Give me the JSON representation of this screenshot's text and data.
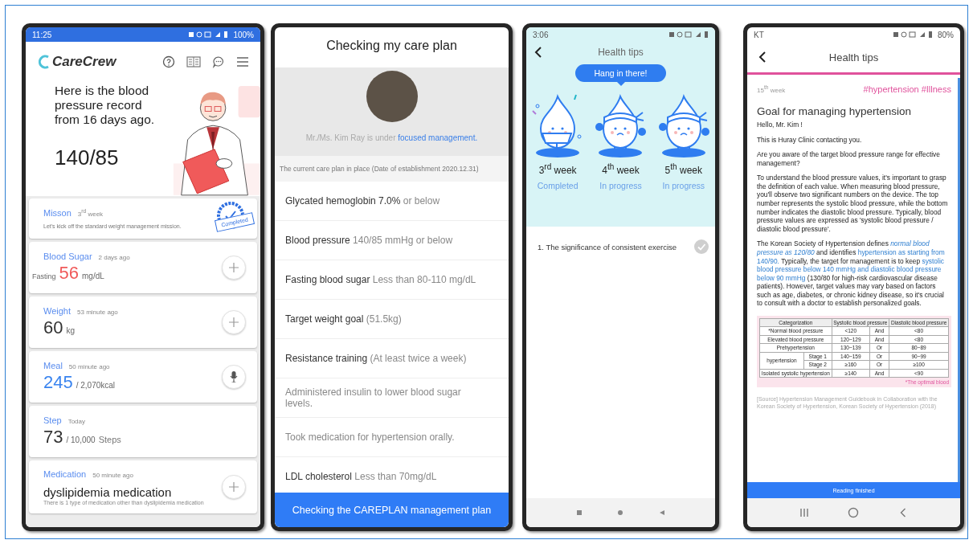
{
  "figure": {
    "phones": [
      {
        "kind": "dashboard",
        "status_bar": {
          "time": "11:25",
          "battery": "100%"
        },
        "logo": "CareCrew",
        "message": "Here is the blood pressure record from 16 days ago.",
        "reading": "140/85",
        "cards": [
          {
            "kind": "mission",
            "title": "Misson",
            "meta": "3$^{rd}$ week",
            "text": "Let's kick off the standard weight management mission.",
            "stamp": "Completed"
          },
          {
            "kind": "measure",
            "title": "Blood Sugar",
            "meta": "2 days ago",
            "prefix": "Fasting",
            "value": "56",
            "unit": "mg/dL",
            "color": "#f05a5a",
            "action": {
              "kind": "add"
            }
          },
          {
            "kind": "measure",
            "title": "Weight",
            "meta": "53 minute ago",
            "value": "60",
            "unit": "kg",
            "color": "#333333",
            "action": {
              "kind": "add"
            }
          },
          {
            "kind": "measure",
            "title": "Meal",
            "meta": "50 minute ago",
            "value": "245",
            "unit": "/ 2,070kcal",
            "color": "#3a84ef",
            "action": {
              "kind": "voice"
            }
          },
          {
            "kind": "measure",
            "title": "Step",
            "meta": "Today",
            "value": "73",
            "unit": "/ 10,000",
            "suffix": "Steps",
            "color": "#333333"
          },
          {
            "kind": "medication",
            "title": "Medication",
            "meta": "50 minute ago",
            "value": "dyslipidemia medication",
            "text": "There is 1 type of medication other than dyslipidemia medication",
            "action": {
              "kind": "add"
            }
          }
        ]
      },
      {
        "kind": "care_plan",
        "title": "Checking my care plan",
        "profile": {
          "text": "Mr./Ms. Kim Ray is under",
          "highlight": "focused management."
        },
        "section": "The current care plan in place (Date of establishment 2020.12.31)",
        "items": [
          {
            "label": "Glycated hemoglobin 7.0%",
            "detail": "or below"
          },
          {
            "label": "Blood pressure",
            "detail": "140/85 mmHg or below"
          },
          {
            "label": "Fasting blood sugar",
            "detail": "Less than 80-110 mg/dL"
          },
          {
            "label": "Target weight goal",
            "detail": "(51.5kg)"
          },
          {
            "label": "Resistance training",
            "detail": "(At least twice a week)"
          },
          {
            "detail": "Administered insulin to lower blood sugar levels."
          },
          {
            "detail": "Took medication for hypertension orally."
          },
          {
            "label": "LDL cholesterol",
            "detail": "Less than 70mg/dL"
          }
        ],
        "button": "Checking the CAREPLAN management plan"
      },
      {
        "kind": "tips_progress",
        "status_bar": {
          "time": "3:06"
        },
        "title": "Health tips",
        "bubble": "Hang in there!",
        "weeks": [
          {
            "kind": "trophy",
            "label": "3$^{rd}$ week",
            "status": "Completed"
          },
          {
            "kind": "exercise",
            "label": "4$^{th}$ week",
            "status": "In progress"
          },
          {
            "kind": "exercise",
            "label": "5$^{th}$ week",
            "status": "In progress"
          }
        ],
        "lessons": [
          {
            "text": "1. The significance of consistent exercise",
            "checked": false
          }
        ]
      },
      {
        "kind": "article",
        "status_bar": {
          "carrier": "KT",
          "battery": "80%"
        },
        "title": "Health tips",
        "week": "15$^{th}$ week",
        "tags": "#hypertension #Illness",
        "heading": "Goal for managing hypertension",
        "paragraphs": [
          [
            {
              "text": "Hello, Mr. Kim !",
              "highlight": false
            }
          ],
          [
            {
              "text": "This is Huray Clinic contacting you.",
              "highlight": false
            }
          ],
          [
            {
              "text": "Are you aware of the target blood pressure range for effective management?",
              "highlight": false
            }
          ],
          [
            {
              "text": "To understand the blood pressure values, it's important to grasp the definition of each value. When measuring blood pressure, you'll observe two significant numbers on the device. The top number represents the systolic blood pressure, while the bottom number indicates the diastolic blood pressure. Typically, blood pressure values are expressed as 'systolic blood pressure / diastolic blood pressure'.",
              "highlight": false
            }
          ],
          [
            {
              "text": "The Korean Society of Hypertension defines ",
              "highlight": false
            },
            {
              "text": "*normal blood pressure as 120/80*",
              "highlight": true
            },
            {
              "text": " and identifies ",
              "highlight": false
            },
            {
              "text": "hypertension as starting from 140/90.",
              "highlight": true
            },
            {
              "text": " Typically, the target for management is to keep ",
              "highlight": false
            },
            {
              "text": "systolic blood pressure below 140 mmHg and diastolic blood pressure below 90 mmHg",
              "highlight": true
            },
            {
              "text": " (130/80 for high-risk cardiovascular disease patients). However, target values may vary based on factors such as age, diabetes, or chronic kidney disease, so it's crucial to consult with a doctor to establish personalized goals.",
              "highlight": false
            }
          ]
        ],
        "table": {
          "columns": [
            "Categorization",
            "Systolic blood pressure",
            "Diastolic blood pressure"
          ],
          "rows": [
            {
              "category": "*Normal blood pressure",
              "systolic": "<120",
              "join": "And",
              "diastolic": "<80"
            },
            {
              "category": "Elevated blood pressure",
              "systolic": "120~129",
              "join": "And",
              "diastolic": "<80"
            },
            {
              "category": "Prehypertension",
              "systolic": "130~139",
              "join": "Or",
              "diastolic": "80~89"
            },
            {
              "category": "hypertension",
              "stages": [
                {
                  "stage": "Stage 1",
                  "systolic": "140~159",
                  "join": "Or",
                  "diastolic": "90~99"
                },
                {
                  "stage": "Stage 2",
                  "systolic": "≥160",
                  "join": "Or",
                  "diastolic": "≥100"
                }
              ]
            },
            {
              "category": "Isolated systolic hypertension",
              "systolic": "≥140",
              "join": "And",
              "diastolic": "<90"
            }
          ],
          "note": "*The optimal blood"
        },
        "source": "[Source] Hypertension Management Guidebook in Collaboration with the Korean Society of Hypertension, Korean Society of Hypertension (2018)",
        "button": "Reading finished"
      }
    ]
  }
}
